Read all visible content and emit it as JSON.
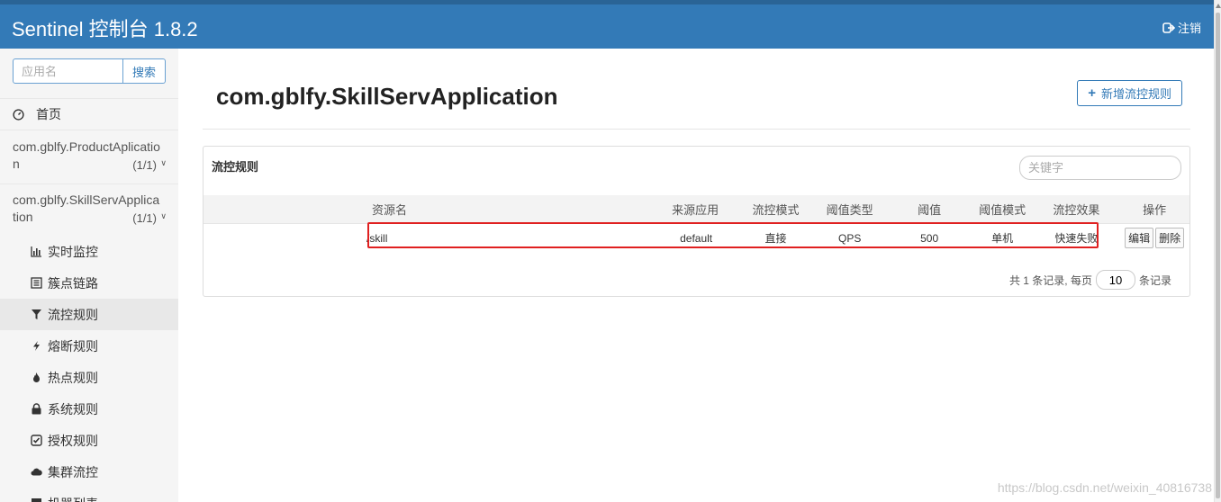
{
  "header": {
    "brand": "Sentinel 控制台 1.8.2",
    "logout_label": "注销"
  },
  "sidebar": {
    "search_placeholder": "应用名",
    "search_button": "搜索",
    "home_label": "首页",
    "apps": [
      {
        "name": "com.gblfy.ProductAplication",
        "count": "(1/1)"
      },
      {
        "name": "com.gblfy.SkillServApplication",
        "count": "(1/1)"
      }
    ],
    "menu": [
      {
        "label": "实时监控",
        "icon": "bar-chart-icon"
      },
      {
        "label": "簇点链路",
        "icon": "list-icon"
      },
      {
        "label": "流控规则",
        "icon": "filter-icon"
      },
      {
        "label": "熔断规则",
        "icon": "bolt-icon"
      },
      {
        "label": "热点规则",
        "icon": "fire-icon"
      },
      {
        "label": "系统规则",
        "icon": "lock-icon"
      },
      {
        "label": "授权规则",
        "icon": "check-square-icon"
      },
      {
        "label": "集群流控",
        "icon": "cloud-icon"
      },
      {
        "label": "机器列表",
        "icon": "server-icon"
      }
    ]
  },
  "main": {
    "title": "com.gblfy.SkillServApplication",
    "add_button": "新增流控规则",
    "panel_title": "流控规则",
    "keyword_placeholder": "关键字",
    "columns": [
      "资源名",
      "来源应用",
      "流控模式",
      "阈值类型",
      "阈值",
      "阈值模式",
      "流控效果",
      "操作"
    ],
    "rows": [
      {
        "resource": "/skill",
        "origin": "default",
        "mode": "直接",
        "threshold_type": "QPS",
        "threshold": "500",
        "threshold_mode": "单机",
        "effect": "快速失败",
        "edit": "编辑",
        "delete": "删除"
      }
    ],
    "pager": {
      "prefix": "共 1 条记录, 每页",
      "page_size": "10",
      "suffix": "条记录"
    }
  },
  "watermark": "https://blog.csdn.net/weixin_40816738",
  "colors": {
    "primary": "#337ab7",
    "highlight": "#e02020"
  }
}
